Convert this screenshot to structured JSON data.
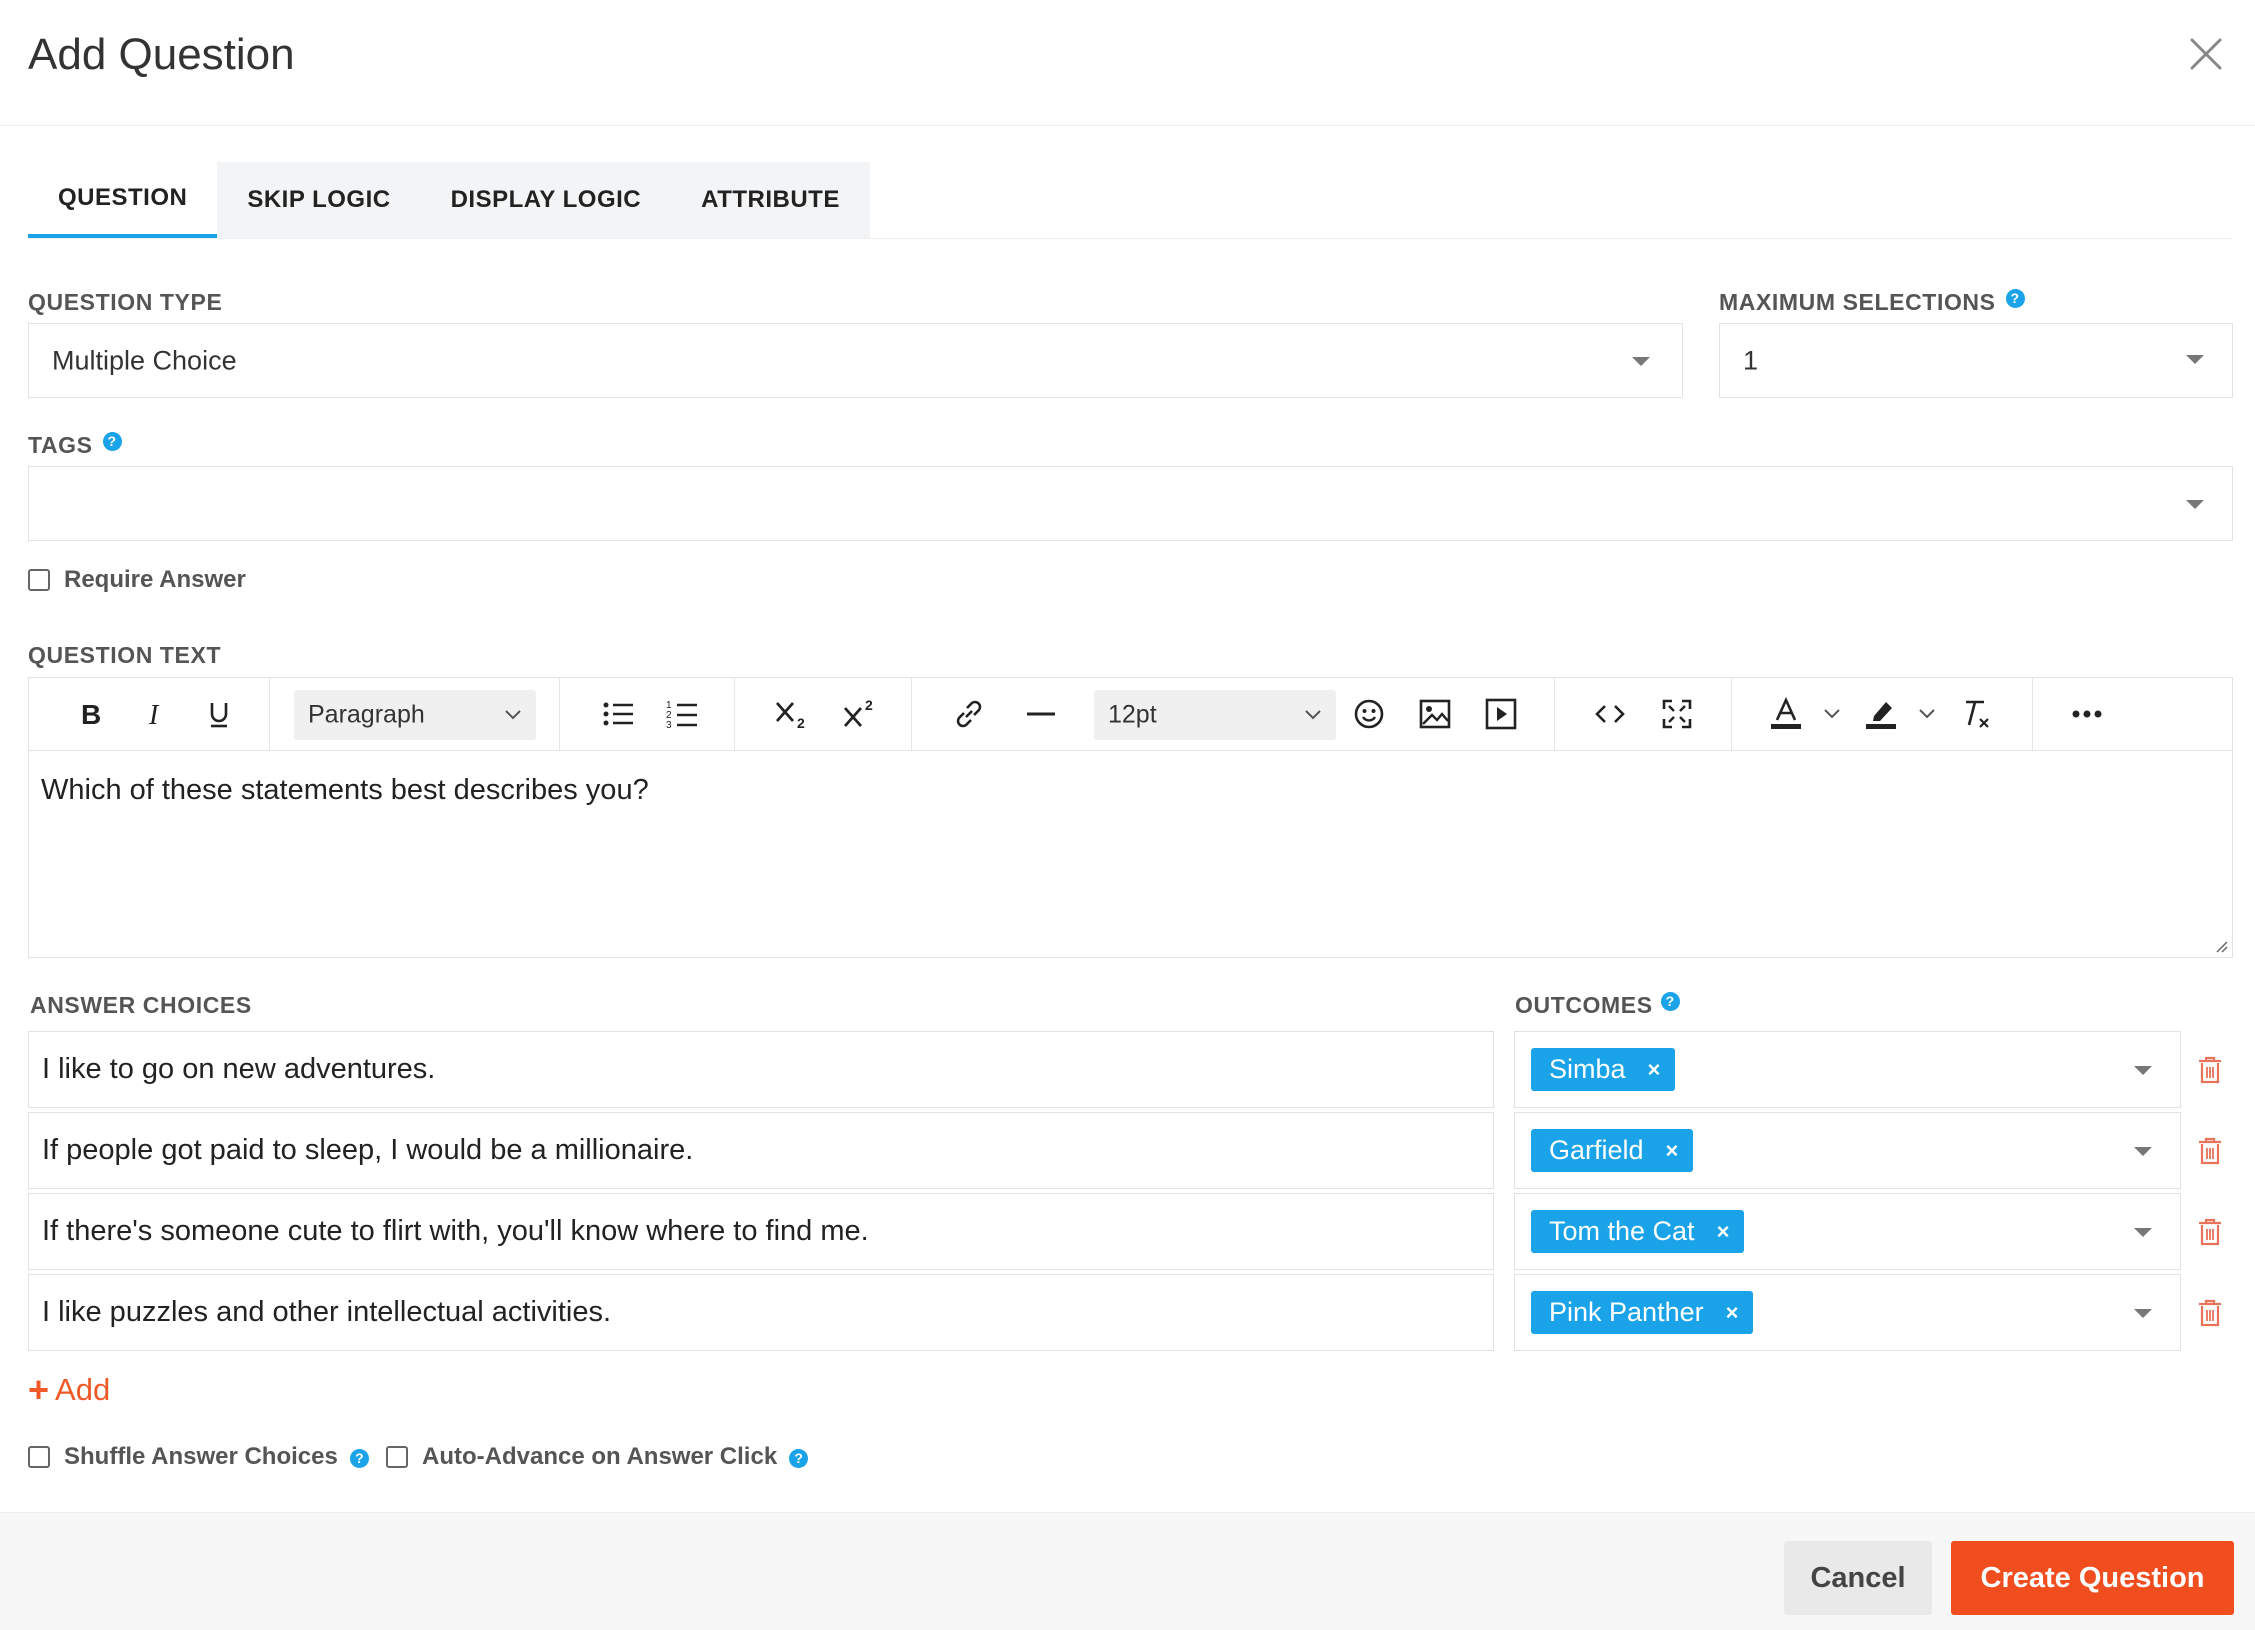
{
  "dialog": {
    "title": "Add Question"
  },
  "tabs": [
    {
      "label": "QUESTION",
      "active": true
    },
    {
      "label": "SKIP LOGIC",
      "active": false
    },
    {
      "label": "DISPLAY LOGIC",
      "active": false
    },
    {
      "label": "ATTRIBUTE",
      "active": false
    }
  ],
  "question_type": {
    "label": "QUESTION TYPE",
    "value": "Multiple Choice"
  },
  "max_selections": {
    "label": "MAXIMUM SELECTIONS",
    "value": "1"
  },
  "tags": {
    "label": "TAGS",
    "value": ""
  },
  "require_answer": {
    "label": "Require Answer",
    "checked": false
  },
  "question_text": {
    "label": "QUESTION TEXT",
    "block_format": "Paragraph",
    "font_size": "12pt",
    "content": "Which of these statements best describes you?"
  },
  "answer_choices": {
    "label": "ANSWER CHOICES",
    "outcomes_label": "OUTCOMES",
    "rows": [
      {
        "text": "I like to go on new adventures.",
        "outcome": "Simba"
      },
      {
        "text": "If people got paid to sleep, I would be a millionaire.",
        "outcome": "Garfield"
      },
      {
        "text": "If there's someone cute to flirt with, you'll know where to find me.",
        "outcome": "Tom the Cat"
      },
      {
        "text": "I like puzzles and other intellectual activities.",
        "outcome": "Pink Panther"
      }
    ],
    "add_label": "Add"
  },
  "options": {
    "shuffle": {
      "label": "Shuffle Answer Choices",
      "checked": false
    },
    "auto_advance": {
      "label": "Auto-Advance on Answer Click",
      "checked": false
    }
  },
  "footer": {
    "cancel_label": "Cancel",
    "create_label": "Create Question"
  },
  "colors": {
    "accent": "#1aa3e8",
    "primary_button": "#f04e1f",
    "add_link": "#f05a28",
    "trash": "#e8735a"
  }
}
